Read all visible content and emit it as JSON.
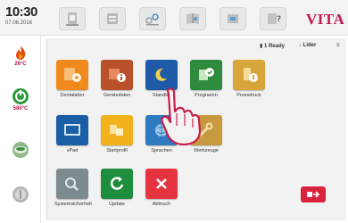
{
  "status": {
    "time": "10:30",
    "date": "07.06.2016"
  },
  "brand": "VITA",
  "toolbar_icons": [
    "oven-icon",
    "tray-icon",
    "chart-icon",
    "book-icon",
    "tools-icon",
    "help-icon"
  ],
  "sidebar": {
    "items": [
      {
        "icon": "flame-icon",
        "value": "26°C",
        "color": "#e84b10"
      },
      {
        "icon": "power-green-icon",
        "value": "580°C",
        "color": "#2a9b3a"
      },
      {
        "icon": "firing-plate-icon",
        "value": ""
      },
      {
        "icon": "info-grey-icon",
        "value": ""
      }
    ]
  },
  "panel": {
    "header": {
      "left": "",
      "items": [
        "▮ 1 Ready",
        "↓ Lider",
        "≡"
      ]
    },
    "tiles": [
      {
        "label": "Dentalabor",
        "icon": "dental-lab-icon",
        "color": "#f08a1d"
      },
      {
        "label": "Gerätedaten",
        "icon": "device-data-icon",
        "color": "#b8512a"
      },
      {
        "label": "Standby",
        "icon": "standby-moon-icon",
        "color": "#1e5aa8"
      },
      {
        "label": "Programm",
        "icon": "program-icon",
        "color": "#2e8b3d"
      },
      {
        "label": "Pressdruck",
        "icon": "press-pressure-icon",
        "color": "#d7a53a"
      },
      {
        "label": "vPad",
        "icon": "vpad-icon",
        "color": "#1a5ea6"
      },
      {
        "label": "Startprofil",
        "icon": "start-profile-icon",
        "color": "#f2b21b"
      },
      {
        "label": "Sprachen",
        "icon": "languages-icon",
        "color": "#2f7bbf"
      },
      {
        "label": "Werkzeuge",
        "icon": "tools-tile-icon",
        "color": "#c89a3f"
      },
      {
        "label": "Systemsicherheit",
        "icon": "system-security-icon",
        "color": "#7b8b8f"
      },
      {
        "label": "Update",
        "icon": "update-icon",
        "color": "#1f8d3e"
      },
      {
        "label": "Abbruch",
        "icon": "cancel-icon",
        "color": "#e5333f"
      }
    ]
  },
  "red_button": {
    "icon": "exit-icon",
    "color": "#d9233d"
  }
}
